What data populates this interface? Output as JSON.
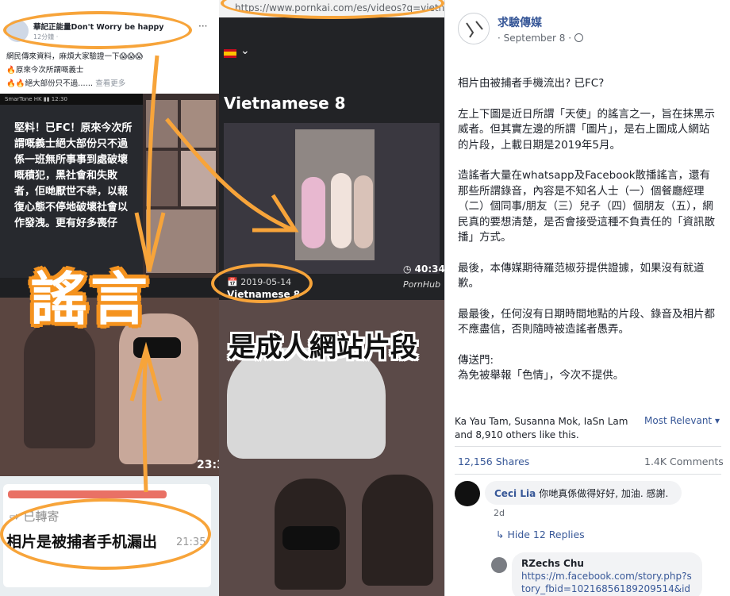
{
  "collage": {
    "fb_snippet": {
      "page_name": "華記正能量Don't Worry be happy",
      "time": "12分鐘 · ",
      "line1": "網民傳來資料，麻煩大家驗證一下😱😱😱",
      "line2": "🔥原來今次所謂嘅義士",
      "line3": "🔥🔥絕大部份只不過……",
      "see_more": " 查看更多"
    },
    "phone_status": "SmarTone HK  ▮▮  12:30",
    "phone_text": "堅料！已FC！原來今次所謂嘅義士絕大部份只不過係一班無所事事到處破壞嘅積犯，黑社會和失敗者，佢哋厭世不恭，以報復心態不停地破壞社會以作發洩。更有好多喪仔",
    "big_label": "謠言",
    "left_duration": "23:3",
    "whatsapp": {
      "forwarded": "⇨ 已轉寄",
      "message": "相片是被捕者手机漏出",
      "time": "21:35"
    },
    "url": "https://www.pornkai.com/es/videos?q=vietna",
    "video_title": "Vietnamese 8",
    "video_duration": "40:34",
    "video_date": "📅 2019-05-14",
    "video_name": "Vietnamese 8",
    "video_source": "PornHub",
    "caption": "是成人網站片段"
  },
  "post": {
    "page_name": "求驗傳媒",
    "date": "· September 8 ·",
    "paragraphs": [
      "相片由被捕者手機流出? 已FC?",
      "左上下圖是近日所謂「天使」的謠言之一，旨在抹黑示威者。但其實左邊的所謂「圖片」，是右上圖成人網站的片段，上載日期是2019年5月。",
      "造謠者大量在whatsapp及Facebook散播謠言，還有那些所謂錄音，內容是不知名人士（一）個餐廳經理（二）個同事/朋友（三）兒子（四）個朋友（五），網民真的要想清楚，是否會接受這種不負責任的「資訊散播」方式。",
      "最後，本傳媒期待羅范椒芬提供證據，如果沒有就道歉。",
      "最最後，任何沒有日期時間地點的片段、錄音及相片都不應盡信，否則隨時被造謠者愚弄。",
      "傳送門:\n為免被舉報「色情」，今次不提供。"
    ],
    "likes_text": "Ka Yau Tam, Susanna Mok, IaSn Lam and 8,910 others like this.",
    "most_relevant": "Most Relevant ▾",
    "shares": "12,156 Shares",
    "comments_count": "1.4K Comments",
    "comment1": {
      "author": "Ceci Lia",
      "text": "你哋真係做得好好, 加油. 感謝.",
      "time": "2d"
    },
    "hide_replies": "↳ Hide 12 Replies",
    "comment2": {
      "author": "RZechs Chu",
      "link": "https://m.facebook.com/story.php?story_fbid=10216856189209514&id="
    }
  },
  "colors": {
    "accent_orange": "#f7a43a",
    "fb_link": "#385898"
  }
}
